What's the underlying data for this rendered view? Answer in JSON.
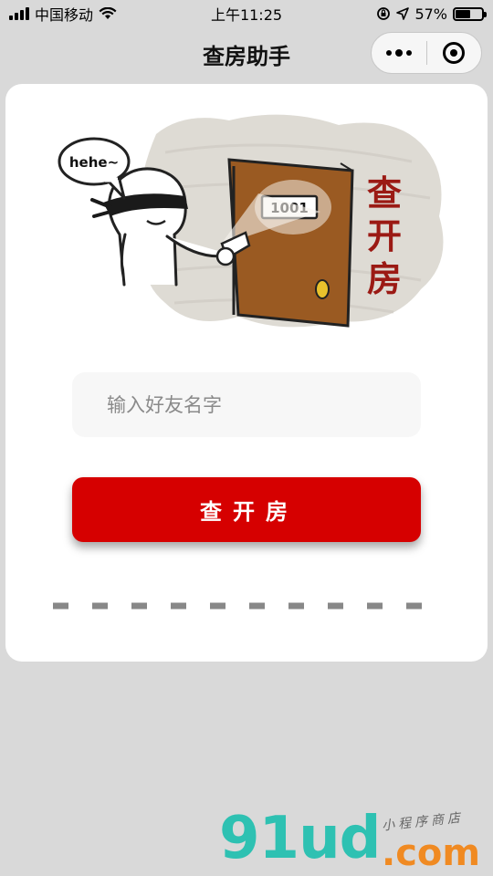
{
  "status_bar": {
    "carrier": "中国移动",
    "time": "上午11:25",
    "battery_percent": "57%",
    "battery_level": 0.57
  },
  "nav": {
    "title": "查房助手",
    "more_icon": "more-dots-icon",
    "close_icon": "target-circle-icon"
  },
  "illustration": {
    "bubble_text": "hehe~",
    "room_number": "1001",
    "side_text": [
      "查",
      "开",
      "房"
    ]
  },
  "form": {
    "input_placeholder": "输入好友名字",
    "input_value": "",
    "button_label": "查开房"
  },
  "watermark": {
    "brand": "91ud",
    "suffix": ".com",
    "tagline": "小程序商店"
  },
  "colors": {
    "accent": "#d60000",
    "background": "#d9d9d9",
    "card": "#ffffff",
    "input_bg": "#f7f7f7",
    "door": "#9a5a22",
    "watermark_teal": "#2ec1b2",
    "watermark_orange": "#f08a22"
  }
}
